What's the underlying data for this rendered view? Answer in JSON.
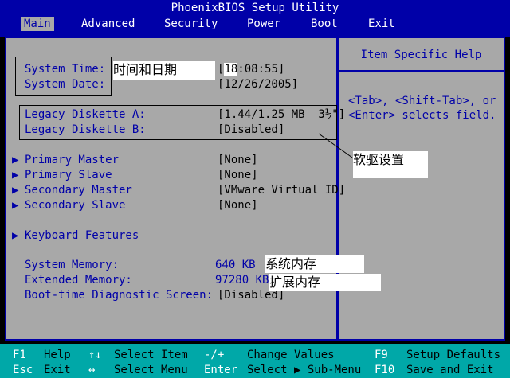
{
  "window": {
    "title": "PhoenixBIOS Setup Utility"
  },
  "menu": {
    "items": [
      {
        "label": "Main",
        "active": true
      },
      {
        "label": "Advanced"
      },
      {
        "label": "Security"
      },
      {
        "label": "Power"
      },
      {
        "label": "Boot"
      },
      {
        "label": "Exit"
      }
    ]
  },
  "main": {
    "system_time": {
      "label": "System Time:",
      "hour": "18",
      "rest": ":08:55]",
      "bracket_open": "["
    },
    "system_date": {
      "label": "System Date:",
      "value": "[12/26/2005]"
    },
    "diskette_a": {
      "label": "Legacy Diskette A:",
      "value": "[1.44/1.25 MB  3½\"]"
    },
    "diskette_b": {
      "label": "Legacy Diskette B:",
      "value": "[Disabled]"
    },
    "primary_master": {
      "label": "Primary Master",
      "value": "[None]"
    },
    "primary_slave": {
      "label": "Primary Slave",
      "value": "[None]"
    },
    "secondary_master": {
      "label": "Secondary Master",
      "value": "[VMware Virtual ID]"
    },
    "secondary_slave": {
      "label": "Secondary Slave",
      "value": "[None]"
    },
    "keyboard_features": {
      "label": "Keyboard Features"
    },
    "system_memory": {
      "label": "System Memory:",
      "value": "640 KB"
    },
    "extended_memory": {
      "label": "Extended Memory:",
      "value": "97280 KB"
    },
    "boot_diag": {
      "label": "Boot-time Diagnostic Screen:",
      "value": "[Disabled]"
    },
    "submenu_arrow": "▶"
  },
  "help": {
    "title": "Item Specific Help",
    "line1": "<Tab>, <Shift-Tab>, or",
    "line2": "<Enter> selects field."
  },
  "annotations": {
    "time_date": "时间和日期",
    "diskette": "软驱设置",
    "system_memory": "系统内存",
    "extended_memory": "扩展内存"
  },
  "footer": {
    "f1_key": "F1",
    "f1_desc": "Help",
    "updown_key": "↑↓",
    "updown_desc": "Select Item",
    "plusminus_key": "-/+",
    "plusminus_desc": "Change Values",
    "f9_key": "F9",
    "f9_desc": "Setup Defaults",
    "esc_key": "Esc",
    "esc_desc": "Exit",
    "leftright_key": "↔",
    "leftright_desc": "Select Menu",
    "enter_key": "Enter",
    "enter_desc": "Select ▶ Sub-Menu",
    "f10_key": "F10",
    "f10_desc": "Save and Exit"
  },
  "colors": {
    "bios_blue": "#0000a8",
    "panel_gray": "#a8a8a8",
    "footer_cyan": "#00a8a8"
  }
}
